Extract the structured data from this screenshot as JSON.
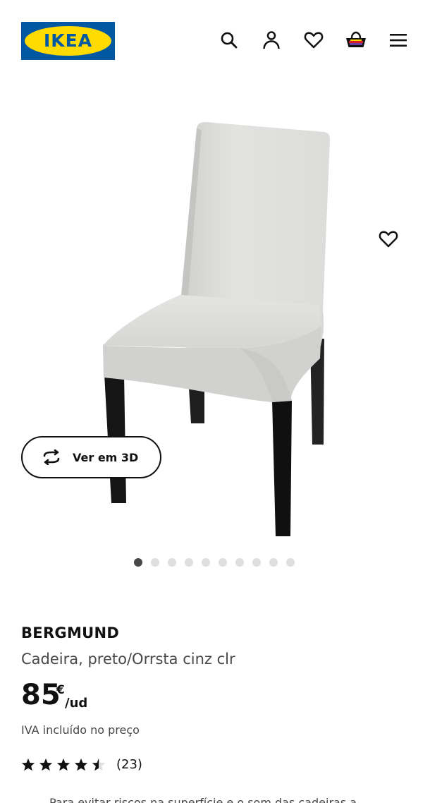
{
  "header": {
    "logo_text": "IKEA",
    "logo_registered": "®",
    "brand_colors": {
      "blue": "#0058a3",
      "yellow": "#ffdb00"
    },
    "icons": [
      "search-icon",
      "user-icon",
      "heart-icon",
      "cart-icon",
      "menu-icon"
    ]
  },
  "gallery": {
    "view_3d_label": "Ver em 3D",
    "image_count": 10,
    "active_index": 0
  },
  "product": {
    "name": "BERGMUND",
    "description": "Cadeira, preto/Orrsta cinz clr",
    "price_integer": "85",
    "currency": "€",
    "unit": "/ud",
    "vat_note": "IVA incluído no preço",
    "rating_value": 4.5,
    "rating_max": 5,
    "rating_count": "(23)",
    "teaser": "Para evitar riscos na superfície e o som das cadeiras a"
  }
}
